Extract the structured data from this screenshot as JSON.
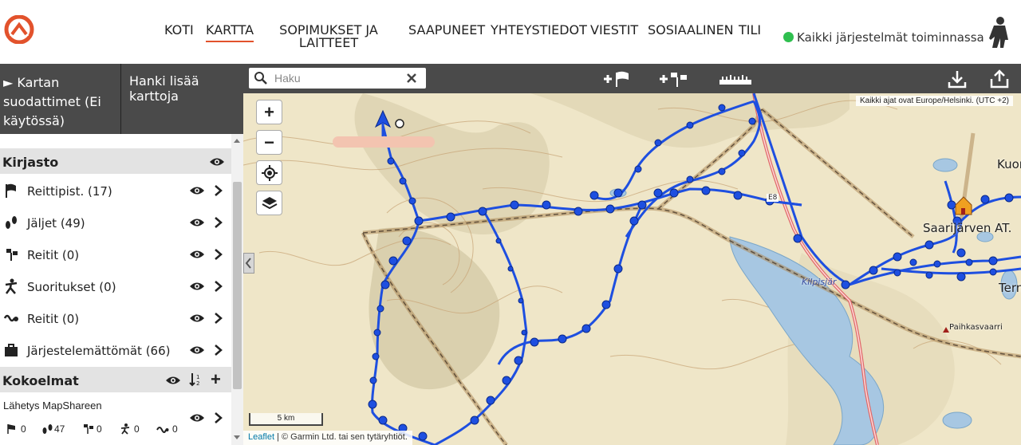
{
  "header": {
    "nav": [
      {
        "label": "KOTI",
        "active": false
      },
      {
        "label": "KARTTA",
        "active": true
      },
      {
        "label": "SOPIMUKSET JA LAITTEET",
        "active": false
      },
      {
        "label": "SAAPUNEET",
        "active": false
      },
      {
        "label": "YHTEYSTIEDOT",
        "active": false
      },
      {
        "label": "VIESTIT",
        "active": false
      },
      {
        "label": "SOSIAALINEN",
        "active": false
      },
      {
        "label": "TILI",
        "active": false
      }
    ],
    "status_text": "Kaikki järjestelmät toiminnassa",
    "status_color": "#2fbf4f",
    "accent_color": "#e2522c"
  },
  "left_panel": {
    "filter_toggle": "► Kartan suodattimet (Ei käytössä)",
    "get_more_maps": "Hanki lisää karttoja",
    "library_title": "Kirjasto",
    "library_items": [
      {
        "icon": "flag-icon",
        "label": "Reittipist. (17)"
      },
      {
        "icon": "footsteps-icon",
        "label": "Jäljet (49)"
      },
      {
        "icon": "route-pin-icon",
        "label": "Reitit (0)"
      },
      {
        "icon": "activity-person-icon",
        "label": "Suoritukset (0)"
      },
      {
        "icon": "route-line-icon",
        "label": "Reitit (0)"
      },
      {
        "icon": "briefcase-icon",
        "label": "Järjestelemättömät (66)"
      }
    ],
    "collections_title": "Kokoelmat",
    "collection_name": "Lähetys MapShareen",
    "collection_counts": [
      "0",
      "47",
      "0",
      "0",
      "0"
    ]
  },
  "map": {
    "search_placeholder": "Haku",
    "timezone_note": "Kaikki ajat ovat Europe/Helsinki. (UTC +2)",
    "scale_label": "5 km",
    "attribution_link": "Leaflet",
    "attribution_text": " | © Garmin Ltd. tai sen tytäryhtiöt.",
    "labels": [
      "Kuon",
      "Saarijärven AT.",
      "Tern",
      "Kilpisjär",
      "Paihkasvaarri",
      "E8"
    ],
    "track_color": "#1e4fe0",
    "road_color": "#e06a6a"
  }
}
